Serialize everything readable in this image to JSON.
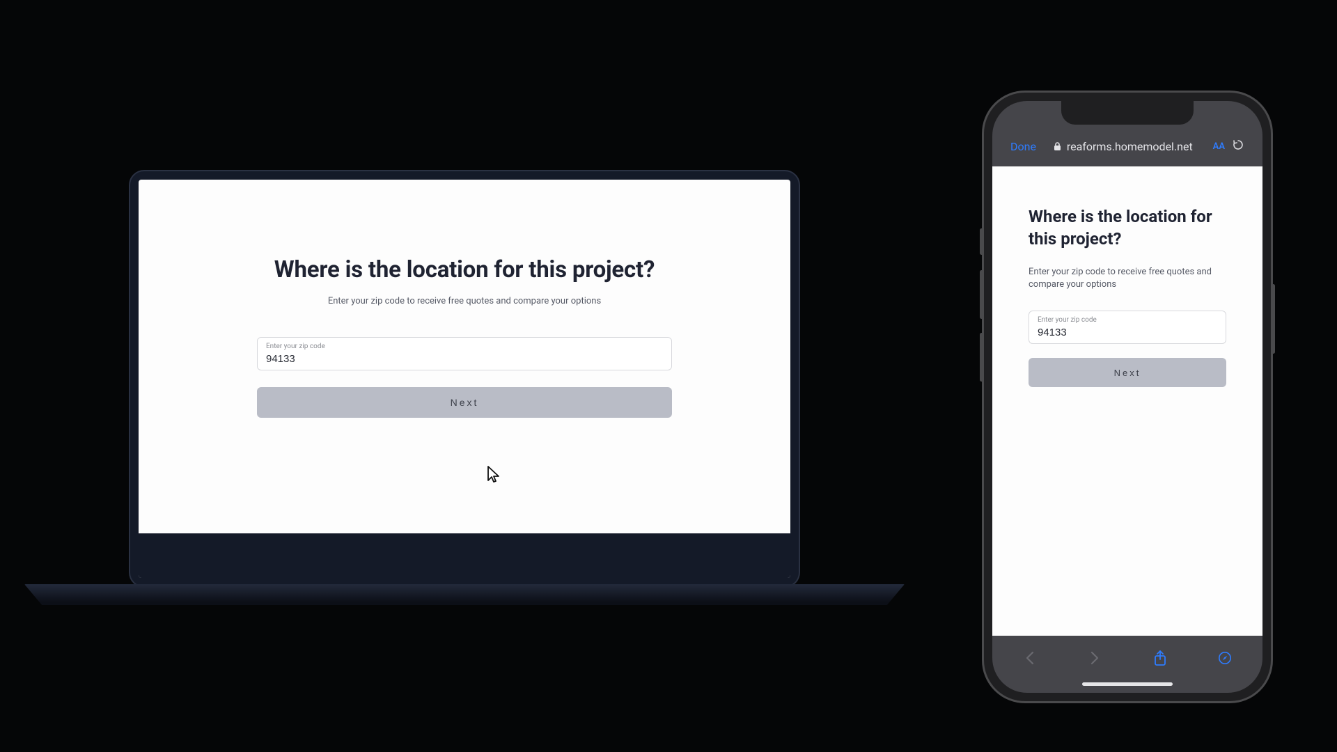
{
  "desktop": {
    "heading": "Where is the location for this project?",
    "subheading": "Enter your zip code to receive free quotes and compare your options",
    "zip_label": "Enter your zip code",
    "zip_value": "94133",
    "next_label": "Next"
  },
  "mobile": {
    "browser": {
      "done_label": "Done",
      "url": "reaforms.homemodel.net",
      "text_size_label": "AA"
    },
    "heading": "Where is the location for this project?",
    "subheading": "Enter your zip code to receive free quotes and compare your options",
    "zip_label": "Enter your zip code",
    "zip_value": "94133",
    "next_label": "Next"
  }
}
